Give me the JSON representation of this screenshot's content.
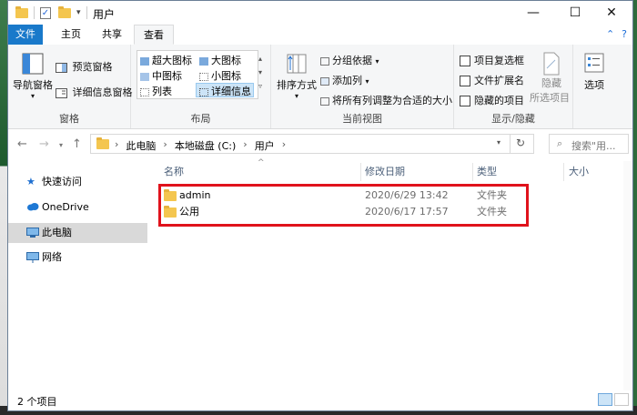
{
  "window": {
    "title": "用户",
    "controls": {
      "minimize": "—",
      "maximize": "☐",
      "close": "✕"
    }
  },
  "tabs": [
    {
      "label": "文件"
    },
    {
      "label": "主页"
    },
    {
      "label": "共享"
    },
    {
      "label": "查看"
    }
  ],
  "ribbon": {
    "panes": {
      "group_label": "窗格",
      "nav_pane": "导航窗格",
      "preview_pane": "预览窗格",
      "details_pane": "详细信息窗格"
    },
    "layout": {
      "group_label": "布局",
      "items": [
        "超大图标",
        "大图标",
        "中图标",
        "小图标",
        "列表",
        "详细信息"
      ]
    },
    "current_view": {
      "group_label": "当前视图",
      "sort_by": "排序方式",
      "group_by": "分组依据",
      "add_column": "添加列",
      "fit_columns": "将所有列调整为合适的大小"
    },
    "show_hide": {
      "group_label": "显示/隐藏",
      "item_checkboxes": "项目复选框",
      "file_extensions": "文件扩展名",
      "hidden_items": "隐藏的项目",
      "hide_selected": "隐藏",
      "hide_selected_sub": "所选项目"
    },
    "options": "选项"
  },
  "address": {
    "breadcrumbs": [
      "此电脑",
      "本地磁盘 (C:)",
      "用户"
    ],
    "search_placeholder": "搜索\"用..."
  },
  "nav_pane": [
    {
      "label": "快速访问",
      "icon": "star-icon"
    },
    {
      "label": "OneDrive",
      "icon": "cloud-icon"
    },
    {
      "label": "此电脑",
      "icon": "computer-icon",
      "selected": true
    },
    {
      "label": "网络",
      "icon": "network-icon"
    }
  ],
  "columns": {
    "name": "名称",
    "date": "修改日期",
    "type": "类型",
    "size": "大小"
  },
  "files": [
    {
      "name": "admin",
      "date": "2020/6/29 13:42",
      "type": "文件夹"
    },
    {
      "name": "公用",
      "date": "2020/6/17 17:57",
      "type": "文件夹"
    }
  ],
  "status": {
    "count": "2 个项目"
  },
  "colors": {
    "accent": "#1979ca",
    "highlight": "#e0121b",
    "folder": "#f4c64f"
  }
}
